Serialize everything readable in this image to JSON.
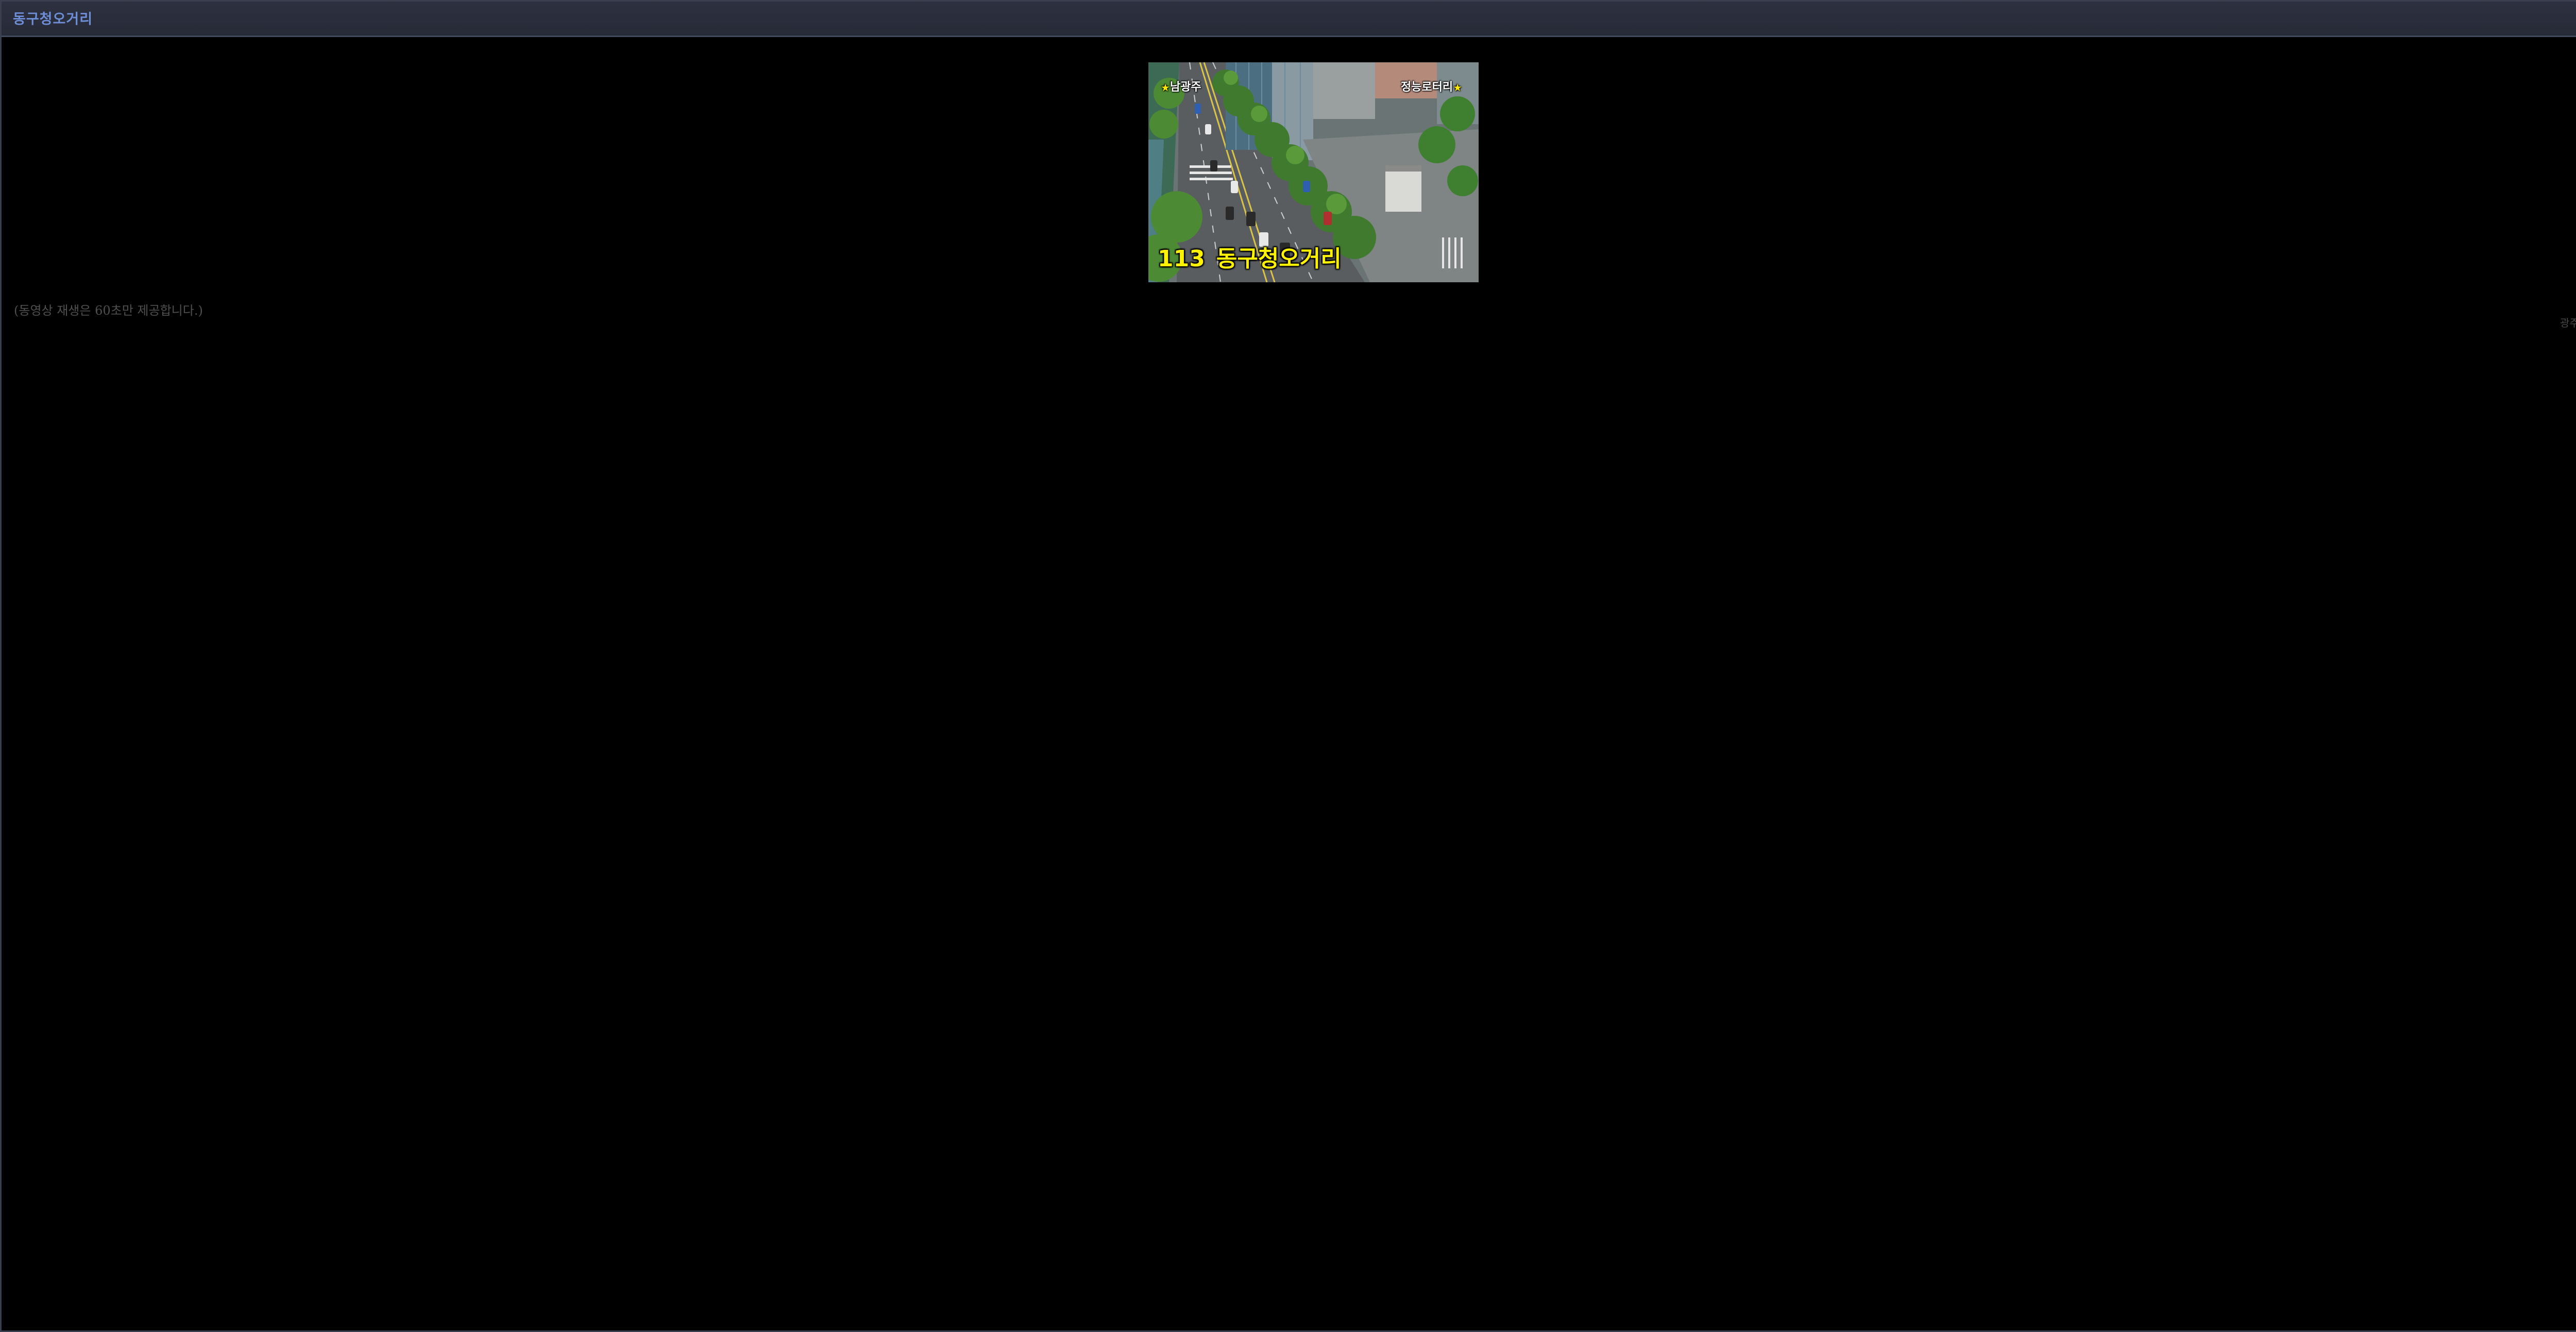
{
  "window": {
    "title": "동구청오거리"
  },
  "camera": {
    "number": "113",
    "name": "동구청오거리",
    "direction_left": "남광주",
    "direction_right": "정능로터리"
  },
  "notice": "(동영상 재생은 60초만 제공합니다.)",
  "agency": "광주광역시",
  "icons": {
    "close": "close-icon",
    "marker": "star-marker-icon"
  },
  "colors": {
    "title": "#6f8ed8",
    "caption": "#fff200",
    "background": "#000000"
  }
}
